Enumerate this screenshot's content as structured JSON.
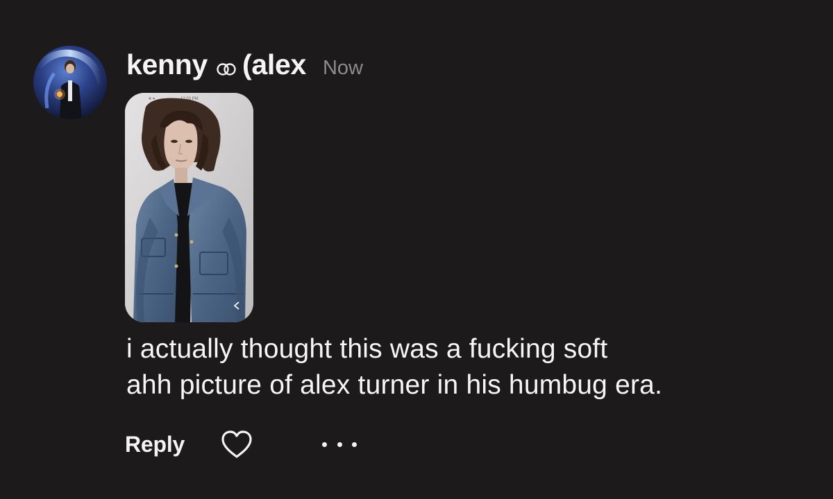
{
  "comment": {
    "author": {
      "name": "kenny",
      "badge_icon": "infinity-link-icon",
      "name_suffix": "(alex",
      "avatar_icon": "avatar-photo"
    },
    "timestamp": "Now",
    "attachment": {
      "type": "phone-screenshot-photo",
      "status_bar_time": "12:03 PM"
    },
    "text_lines": [
      "i actually thought this was a fucking soft",
      "ahh picture of alex turner in his humbug era."
    ],
    "actions": {
      "reply_label": "Reply",
      "like_icon": "heart-icon",
      "more_icon": "more-dots-icon"
    }
  },
  "colors": {
    "background": "#1c1a1b",
    "text": "#f4f2f3",
    "muted": "#8e8b8d"
  }
}
